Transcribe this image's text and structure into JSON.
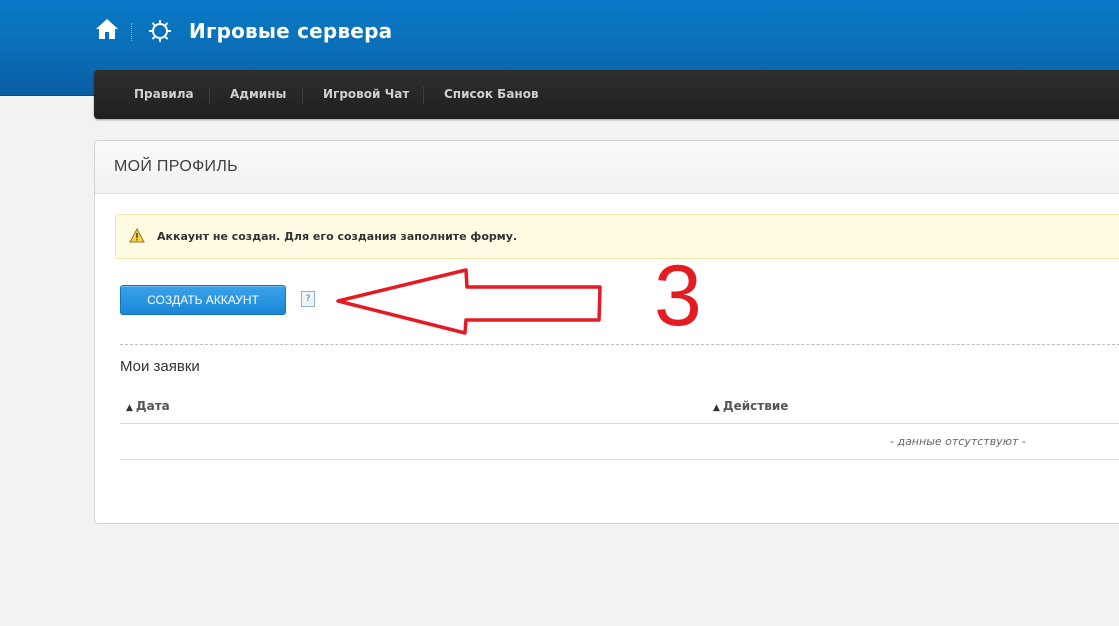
{
  "header": {
    "site_title": "Игровые сервера",
    "home_icon": "home-icon",
    "logo_icon": "gear-icon",
    "bg_color": "#0b6db6"
  },
  "nav": {
    "items": [
      {
        "label": "Правила"
      },
      {
        "label": "Админы"
      },
      {
        "label": "Игровой Чат"
      },
      {
        "label": "Список Банов"
      }
    ]
  },
  "profile": {
    "title": "МОЙ ПРОФИЛЬ",
    "alert_text": "Аккаунт не создан. Для его создания заполните форму.",
    "alert_icon": "warning-icon",
    "create_button": "СОЗДАТЬ АККАУНТ",
    "help_label": "?",
    "requests_title": "Мои заявки",
    "table": {
      "columns": [
        "Дата",
        "Действие"
      ],
      "empty_text": "- данные отсутствуют -"
    }
  },
  "annotation": {
    "number": "3",
    "color": "#e41b23"
  }
}
